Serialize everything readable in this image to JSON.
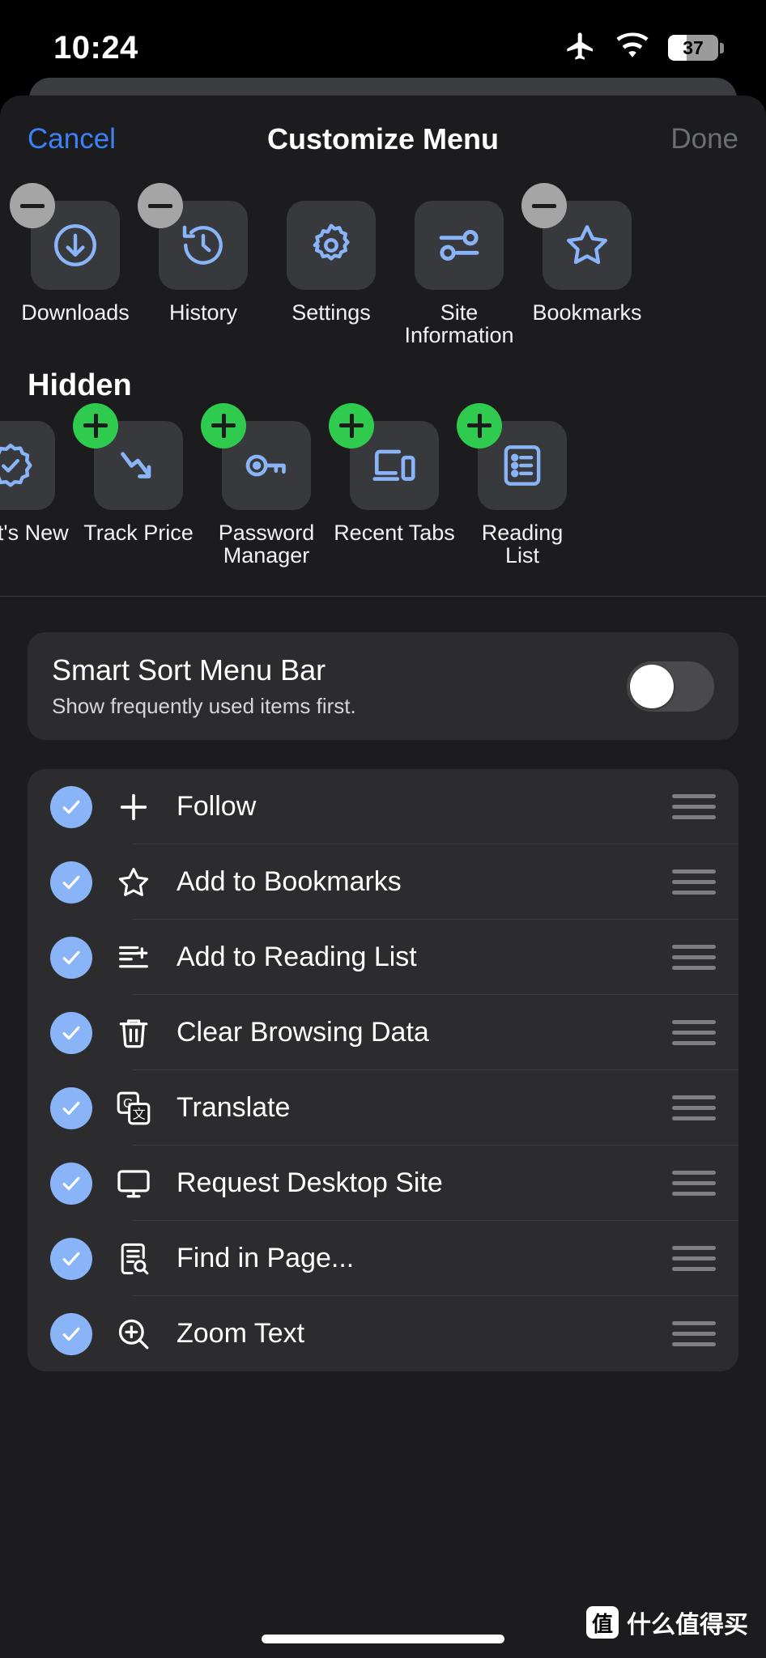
{
  "statusbar": {
    "time": "10:24",
    "airplane_icon": "airplane-icon",
    "wifi_icon": "wifi-icon",
    "battery_level": "37"
  },
  "navbar": {
    "cancel_label": "Cancel",
    "title": "Customize Menu",
    "done_label": "Done"
  },
  "colors": {
    "accent_blue": "#3b82f6",
    "icon_blue": "#8ab4f8",
    "add_green": "#2fcb4f",
    "remove_gray": "#a5a5a5",
    "sheet_bg": "#1c1c1e",
    "card_bg": "#2c2c2e",
    "tile_bg": "#37393d"
  },
  "visible_section": {
    "items": [
      {
        "label": "Downloads",
        "icon": "download-circle-icon",
        "badge": "minus"
      },
      {
        "label": "History",
        "icon": "history-clock-icon",
        "badge": "minus"
      },
      {
        "label": "Settings",
        "icon": "gear-icon",
        "badge": "none"
      },
      {
        "label": "Site Information",
        "icon": "sliders-icon",
        "badge": "none"
      },
      {
        "label": "Bookmarks",
        "icon": "star-icon",
        "badge": "minus"
      }
    ]
  },
  "hidden_section": {
    "title": "Hidden",
    "items": [
      {
        "label": "What's New",
        "icon": "seal-check-icon",
        "badge": "none"
      },
      {
        "label": "Track Price",
        "icon": "trending-down-icon",
        "badge": "plus"
      },
      {
        "label": "Password Manager",
        "icon": "key-icon",
        "badge": "plus"
      },
      {
        "label": "Recent Tabs",
        "icon": "devices-icon",
        "badge": "plus"
      },
      {
        "label": "Reading List",
        "icon": "list-bullet-icon",
        "badge": "plus"
      }
    ]
  },
  "smart_sort": {
    "title": "Smart Sort Menu Bar",
    "subtitle": "Show frequently used items first.",
    "toggle_state": "off"
  },
  "menu_list": {
    "rows": [
      {
        "label": "Follow",
        "icon": "plus-icon",
        "checked": true
      },
      {
        "label": "Add to Bookmarks",
        "icon": "star-outline-icon",
        "checked": true
      },
      {
        "label": "Add to Reading List",
        "icon": "add-reading-list-icon",
        "checked": true
      },
      {
        "label": "Clear Browsing Data",
        "icon": "trash-icon",
        "checked": true
      },
      {
        "label": "Translate",
        "icon": "translate-icon",
        "checked": true
      },
      {
        "label": "Request Desktop Site",
        "icon": "desktop-icon",
        "checked": true
      },
      {
        "label": "Find in Page...",
        "icon": "find-in-page-icon",
        "checked": true
      },
      {
        "label": "Zoom Text",
        "icon": "zoom-text-icon",
        "checked": true
      }
    ]
  },
  "watermark": {
    "logo_char": "值",
    "text": "什么值得买"
  }
}
